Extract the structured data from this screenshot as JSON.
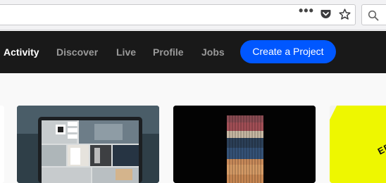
{
  "browser": {
    "more_label": "•••"
  },
  "nav": {
    "items": [
      {
        "label": "Activity",
        "active": true
      },
      {
        "label": "Discover",
        "active": false
      },
      {
        "label": "Live",
        "active": false
      },
      {
        "label": "Profile",
        "active": false
      },
      {
        "label": "Jobs",
        "active": false
      }
    ],
    "cta_label": "Create a Project",
    "cta_color": "#0057ff",
    "bar_color": "#191919"
  },
  "cards": {
    "partial_text": "EE"
  }
}
